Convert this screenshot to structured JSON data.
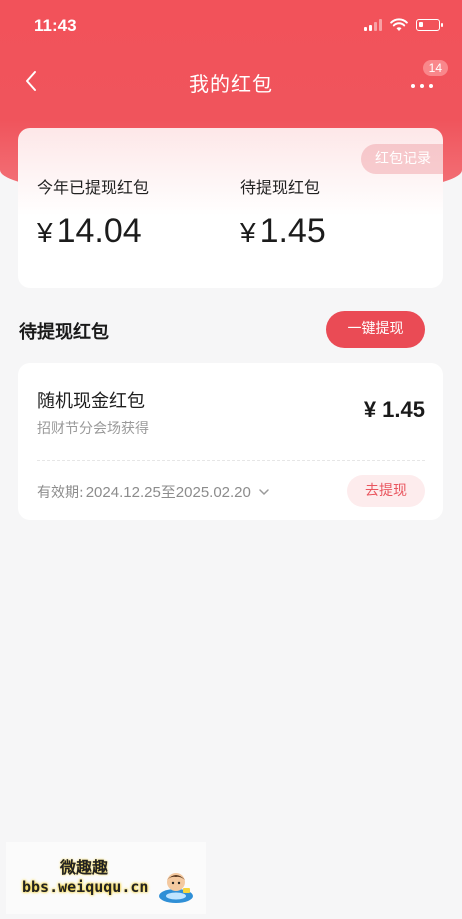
{
  "status_bar": {
    "time": "11:43"
  },
  "nav": {
    "title": "我的红包",
    "badge_count": "14",
    "icons": [
      "back-icon",
      "more-icon"
    ]
  },
  "summary": {
    "record_button": "红包记录",
    "withdrawn_label": "今年已提现红包",
    "withdrawn_currency": "¥",
    "withdrawn_value": "14.04",
    "pending_label": "待提现红包",
    "pending_currency": "¥",
    "pending_value": "1.45"
  },
  "section": {
    "title": "待提现红包",
    "one_click_button": "一键提现"
  },
  "packets": [
    {
      "name": "随机现金红包",
      "source": "招财节分会场获得",
      "amount": "¥ 1.45",
      "validity_label": "有效期:",
      "validity_dates": "2024.12.25至2025.02.20",
      "withdraw_button": "去提现"
    }
  ],
  "watermark": {
    "title": "微趣趣",
    "url": "bbs.weiququ.cn"
  },
  "colors": {
    "header_red": "#f2525a",
    "button_red": "#ea4b55",
    "withdraw_bg": "#fdeced",
    "withdraw_text": "#e9555e",
    "page_bg": "#f6f6f7"
  }
}
